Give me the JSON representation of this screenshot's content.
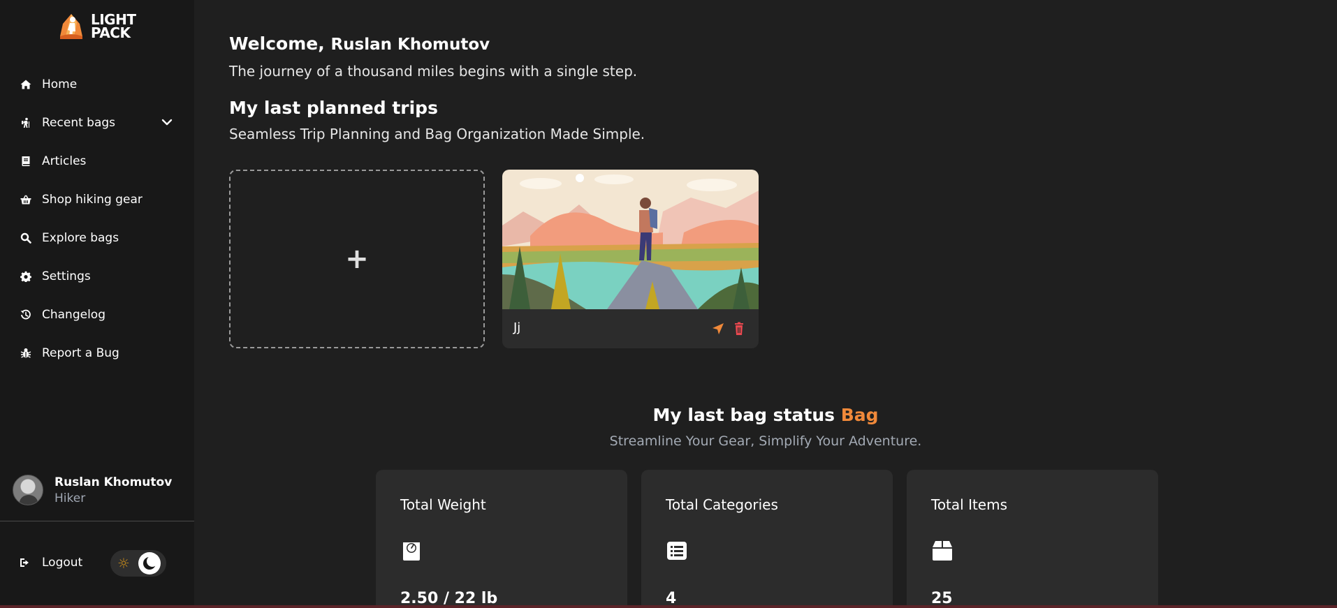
{
  "brand": {
    "line1": "LIGHT",
    "line2": "PACK",
    "accent_color": "#f0893a"
  },
  "sidebar": {
    "items": [
      {
        "label": "Home",
        "icon": "home-icon"
      },
      {
        "label": "Recent bags",
        "icon": "hiker-icon",
        "has_chevron": true
      },
      {
        "label": "Articles",
        "icon": "book-icon"
      },
      {
        "label": "Shop hiking gear",
        "icon": "basket-icon"
      },
      {
        "label": "Explore bags",
        "icon": "search-icon"
      },
      {
        "label": "Settings",
        "icon": "gear-icon"
      },
      {
        "label": "Changelog",
        "icon": "history-icon"
      },
      {
        "label": "Report a Bug",
        "icon": "bug-icon"
      }
    ],
    "user": {
      "name": "Ruslan Khomutov",
      "role": "Hiker"
    },
    "logout_label": "Logout",
    "theme": "dark"
  },
  "main": {
    "welcome_prefix": "Welcome,",
    "welcome_name": "Ruslan Khomutov",
    "welcome_subtitle": "The journey of a thousand miles begins with a single step.",
    "trips_title": "My last planned trips",
    "trips_subtitle": "Seamless Trip Planning and Bag Organization Made Simple.",
    "add_trip_symbol": "+",
    "trips": [
      {
        "name": "Jj"
      }
    ],
    "status_title": "My last bag status",
    "status_accent": "Bag",
    "status_subtitle": "Streamline Your Gear, Simplify Your Adventure.",
    "stats": [
      {
        "title": "Total Weight",
        "icon": "scale-icon",
        "value": "2.50 / 22 lb"
      },
      {
        "title": "Total Categories",
        "icon": "list-icon",
        "value": "4"
      },
      {
        "title": "Total Items",
        "icon": "box-icon",
        "value": "25"
      }
    ]
  }
}
